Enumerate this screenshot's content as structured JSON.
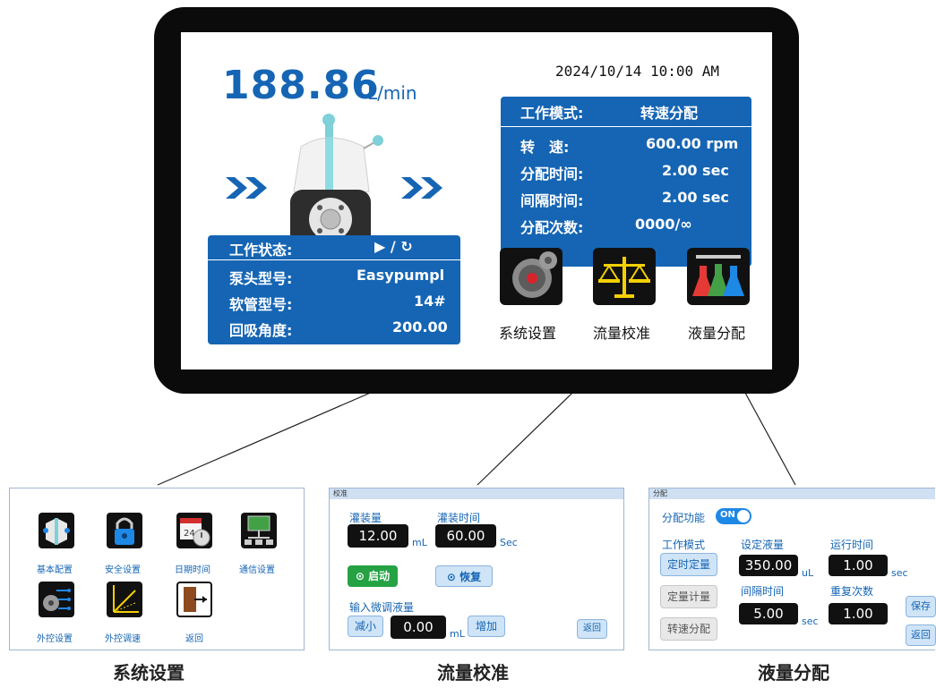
{
  "device": {
    "flow_value": "188.86",
    "flow_unit": "L/min",
    "datetime": "2024/10/14 10:00 AM",
    "mode_panel": {
      "rows": [
        {
          "label": "工作模式:",
          "value": "转速分配"
        },
        {
          "label": "转　速:",
          "value": "600.00 rpm"
        },
        {
          "label": "分配时间:",
          "value": "2.00 sec"
        },
        {
          "label": "间隔时间:",
          "value": "2.00 sec"
        },
        {
          "label": "分配次数:",
          "value": "0000/∞"
        }
      ]
    },
    "status_panel": {
      "rows": [
        {
          "label": "工作状态:",
          "value": "▶ / ↻"
        },
        {
          "label": "泵头型号:",
          "value": "Easypumpl"
        },
        {
          "label": "软管型号:",
          "value": "14#"
        },
        {
          "label": "回吸角度:",
          "value": "200.00"
        }
      ]
    },
    "menu": [
      {
        "label": "系统设置",
        "icon": "gear-icon"
      },
      {
        "label": "流量校准",
        "icon": "scale-icon"
      },
      {
        "label": "液量分配",
        "icon": "flask-icon"
      }
    ]
  },
  "system_settings": {
    "items": [
      {
        "label": "基本配置",
        "icon": "pump-config-icon"
      },
      {
        "label": "安全设置",
        "icon": "lock-icon"
      },
      {
        "label": "日期时间",
        "icon": "calendar-clock-icon"
      },
      {
        "label": "通信设置",
        "icon": "network-icon"
      },
      {
        "label": "外控设置",
        "icon": "external-control-icon"
      },
      {
        "label": "外控调速",
        "icon": "speed-graph-icon"
      },
      {
        "label": "返回",
        "icon": "exit-door-icon"
      }
    ],
    "caption": "系统设置"
  },
  "calibration": {
    "title": "校准",
    "fill_volume_label": "灌装量",
    "fill_volume_value": "12.00",
    "fill_volume_unit": "mL",
    "fill_time_label": "灌装时间",
    "fill_time_value": "60.00",
    "fill_time_unit": "Sec",
    "start_label": "启动",
    "restore_label": "恢复",
    "fine_adjust_label": "输入微调液量",
    "decrease_label": "减小",
    "adjust_value": "0.00",
    "adjust_unit": "mL",
    "increase_label": "增加",
    "back_label": "返回",
    "caption": "流量校准"
  },
  "dispense": {
    "title": "分配",
    "function_label": "分配功能",
    "toggle_label": "ON",
    "work_mode_label": "工作模式",
    "modes": [
      "定时定量",
      "定量计量",
      "转速分配"
    ],
    "set_volume_label": "设定液量",
    "set_volume_value": "350.00",
    "set_volume_unit": "uL",
    "run_time_label": "运行时间",
    "run_time_value": "1.00",
    "run_time_unit": "sec",
    "interval_label": "间隔时间",
    "interval_value": "5.00",
    "interval_unit": "sec",
    "repeat_label": "重复次数",
    "repeat_value": "1.00",
    "save_label": "保存",
    "back_label": "返回",
    "caption": "液量分配"
  },
  "colors": {
    "accent": "#1565b4",
    "panel_bg": "#1565b4",
    "start_green": "#25a244"
  }
}
